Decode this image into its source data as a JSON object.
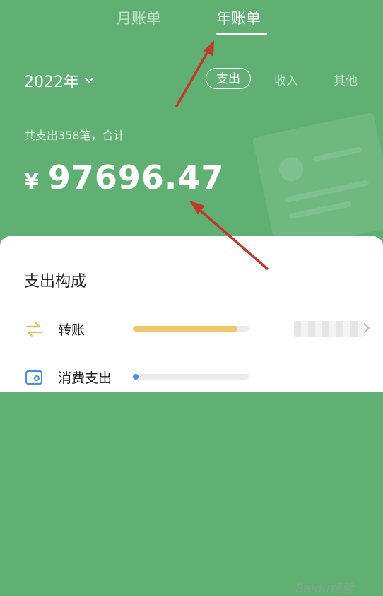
{
  "tabs": {
    "month": "月账单",
    "year": "年账单"
  },
  "year_select": {
    "label": "2022年"
  },
  "segments": {
    "expense": "支出",
    "income": "收入",
    "other": "其他"
  },
  "summary": "共支出358笔，合计",
  "total": {
    "symbol": "¥",
    "value": "97696.47"
  },
  "breakdown": {
    "title": "支出构成",
    "items": [
      {
        "label": "转账",
        "icon": "transfer-icon",
        "progress": 0.9,
        "color": "#f2c76b"
      },
      {
        "label": "消费支出",
        "icon": "shopping-icon",
        "progress": 0.05,
        "color": "#4a8fe0"
      }
    ]
  },
  "watermark": "Baidu经验",
  "colors": {
    "header_bg": "#5fb072",
    "arrow": "#c0392b"
  }
}
